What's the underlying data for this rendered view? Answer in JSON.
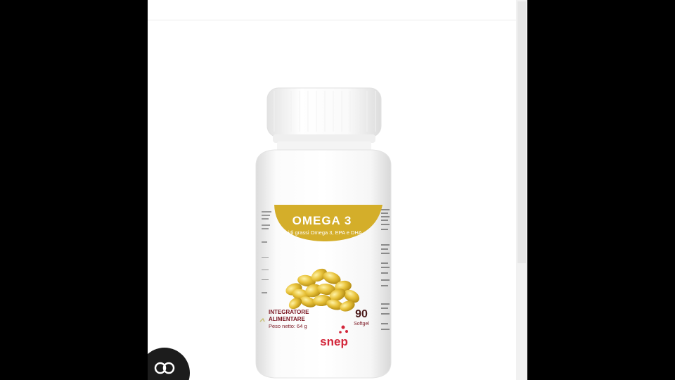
{
  "product": {
    "name": "OMEGA 3",
    "subtitle": "Acidi grassi Omega 3, EPA e DHA",
    "category_line1": "INTEGRATORE",
    "category_line2": "ALIMENTARE",
    "net_weight": "Peso netto: 64 g",
    "count": "90",
    "count_unit": "Softgel",
    "brand": "snep"
  },
  "colors": {
    "band": "#d4ae2a",
    "capsule": "#e8c23a",
    "brand": "#d3263a",
    "maroon": "#7a1520"
  },
  "icons": {
    "chat_fab": "chat-bubble-icon"
  }
}
